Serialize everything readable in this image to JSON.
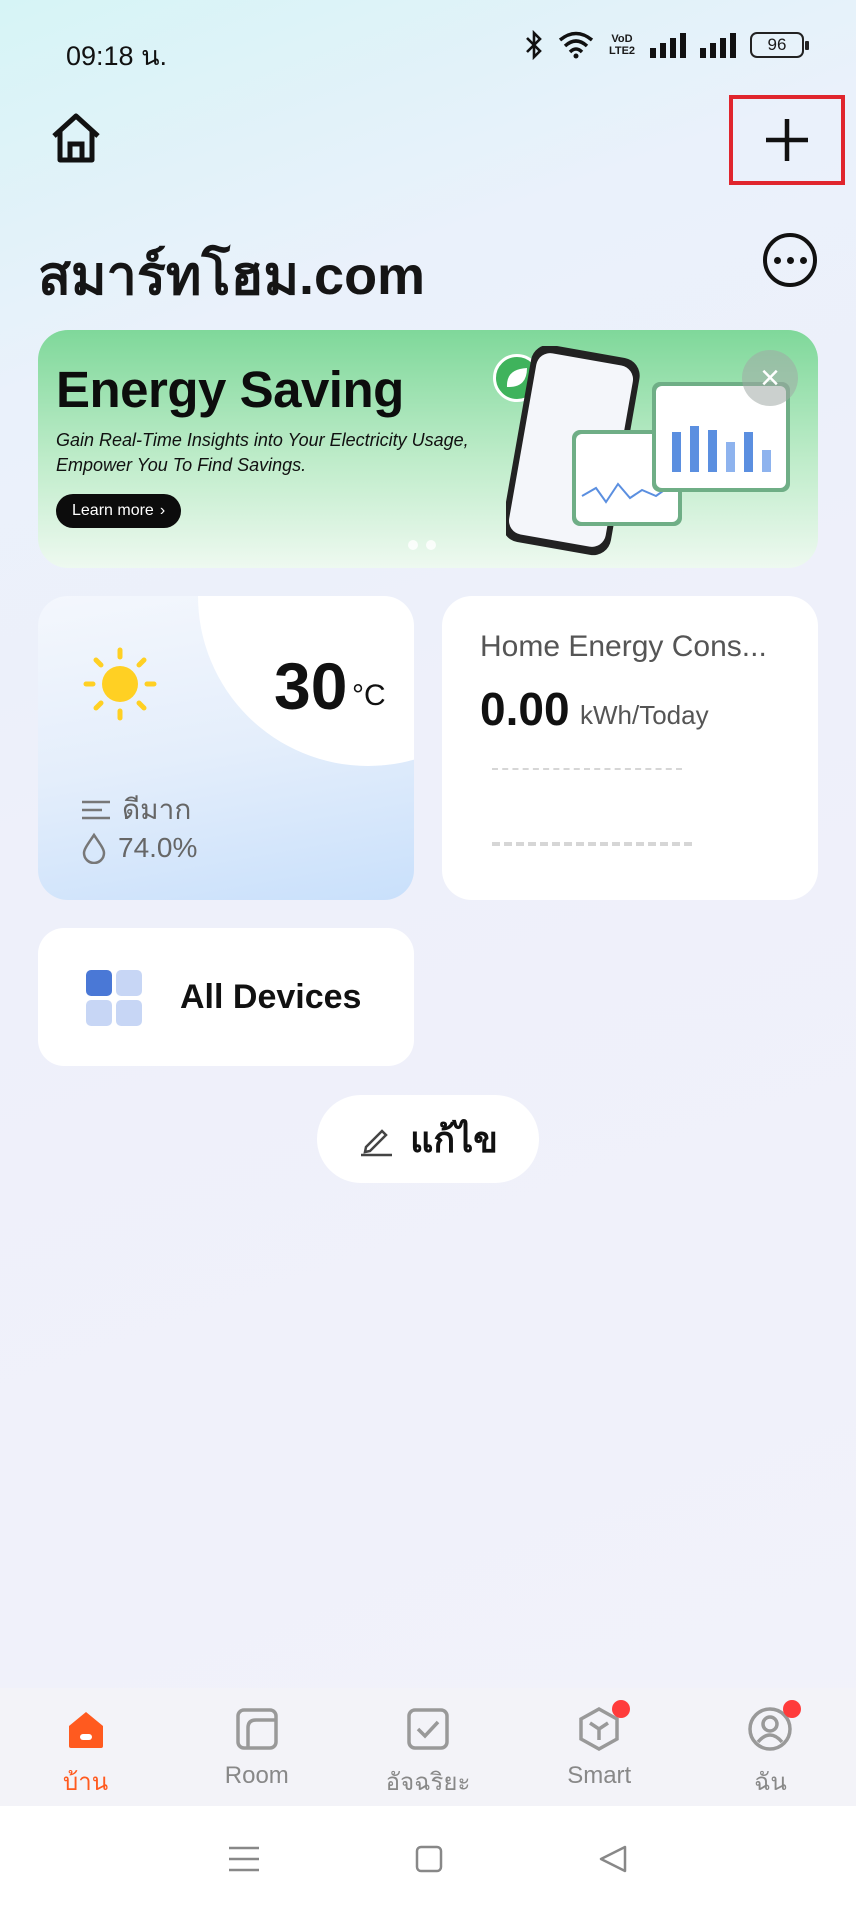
{
  "status_bar": {
    "time": "09:18 น.",
    "battery": "96",
    "network_label": "VoD LTE2"
  },
  "header": {
    "title": "สมาร์ทโฮม.com"
  },
  "banner": {
    "title": "Energy Saving",
    "subtitle": "Gain Real-Time Insights into Your Electricity Usage, Empower You To Find Savings.",
    "button_label": "Learn more",
    "accent_color": "#3fb35c"
  },
  "weather": {
    "temperature": "30",
    "unit": "°C",
    "air_quality": "ดีมาก",
    "humidity": "74.0%"
  },
  "energy": {
    "title": "Home Energy Cons...",
    "value": "0.00",
    "unit": "kWh/Today"
  },
  "devices": {
    "label": "All Devices"
  },
  "edit": {
    "label": "แก้ไข"
  },
  "tabbar": {
    "active_color": "#ff5a1f",
    "items": [
      {
        "label": "บ้าน",
        "icon": "home-icon"
      },
      {
        "label": "Room",
        "icon": "room-icon"
      },
      {
        "label": "อัจฉริยะ",
        "icon": "smart-scene-icon"
      },
      {
        "label": "Smart",
        "icon": "smart-cube-icon"
      },
      {
        "label": "ฉัน",
        "icon": "profile-icon"
      }
    ]
  }
}
